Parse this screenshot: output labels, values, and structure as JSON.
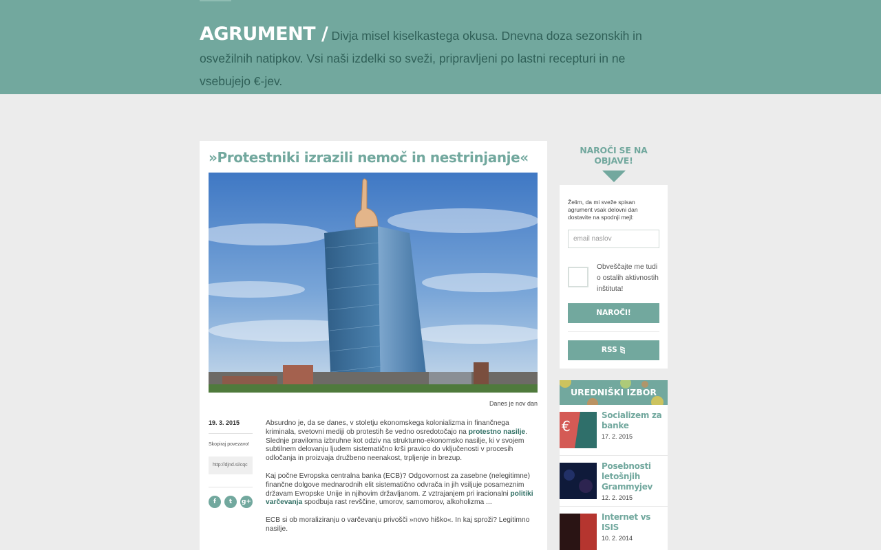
{
  "header": {
    "brand": "AGRUMENT /",
    "tagline": "Divja misel kiselkastega okusa. Dnevna doza sezonskih in osvežilnih natipkov. Vsi naši izdelki so sveži, pripravljeni po lastni recepturi in ne vsebujejo €-jev."
  },
  "article": {
    "title": "»Protestniki izrazili nemoč in nestrinjanje«",
    "image_caption": "Danes je nov dan",
    "date": "19. 3. 2015",
    "copy_link_label": "Skopiraj povezavo!",
    "short_link": "http://djnd.si/cqc",
    "social": [
      "f",
      "t",
      "g+"
    ],
    "paragraphs": [
      {
        "before": "Absurdno je, da se danes, v stoletju ekonomskega kolonializma in finančnega kriminala, svetovni mediji ob protestih še vedno osredotočajo na ",
        "link": "protestno nasilje",
        "after": ". Slednje praviloma izbruhne kot odziv na strukturno-ekonomsko nasilje, ki v svojem subtilnem delovanju ljudem sistematično krši pravico do vključenosti v procesih odločanja in proizvaja družbeno neenakost, trpljenje in brezup."
      },
      {
        "before": "Kaj počne Evropska centralna banka (ECB)? Odgovornost za zasebne (nelegitimne) finančne dolgove mednarodnih elit sistematično odvrača in jih vsiljuje posameznim državam Evropske Unije in njihovim državljanom. Z vztrajanjem pri iracionalni ",
        "link": "politiki varčevanja",
        "after": " spodbuja rast revščine, umorov, samomorov, alkoholizma ..."
      },
      {
        "before": "ECB si ob moraliziranju o varčevanju privošči »novo hiško«. In kaj sproži? Legitimno nasilje.",
        "link": "",
        "after": ""
      }
    ]
  },
  "subscribe": {
    "heading": "NAROČI SE NA OBJAVE!",
    "intro": "Želim, da mi sveže spisan agrument vsak delovni dan dostavite na spodnji mejl:",
    "email_placeholder": "email naslov",
    "checkbox_label": "Obveščajte me tudi o ostalih aktivnostih inštituta!",
    "button_label": "NAROČI!",
    "rss_label": "RSS"
  },
  "editors_picks": {
    "heading": "UREDNIŠKI IZBOR",
    "items": [
      {
        "title": "Socializem za banke",
        "date": "17. 2. 2015"
      },
      {
        "title": "Posebnosti letošnjih Grammyjev",
        "date": "12. 2. 2015"
      },
      {
        "title": "Internet vs ISIS",
        "date": "10. 2. 2014"
      }
    ]
  },
  "colors": {
    "accent": "#72a89e",
    "header_text_dark": "#2f5f57",
    "background": "#ececec"
  }
}
